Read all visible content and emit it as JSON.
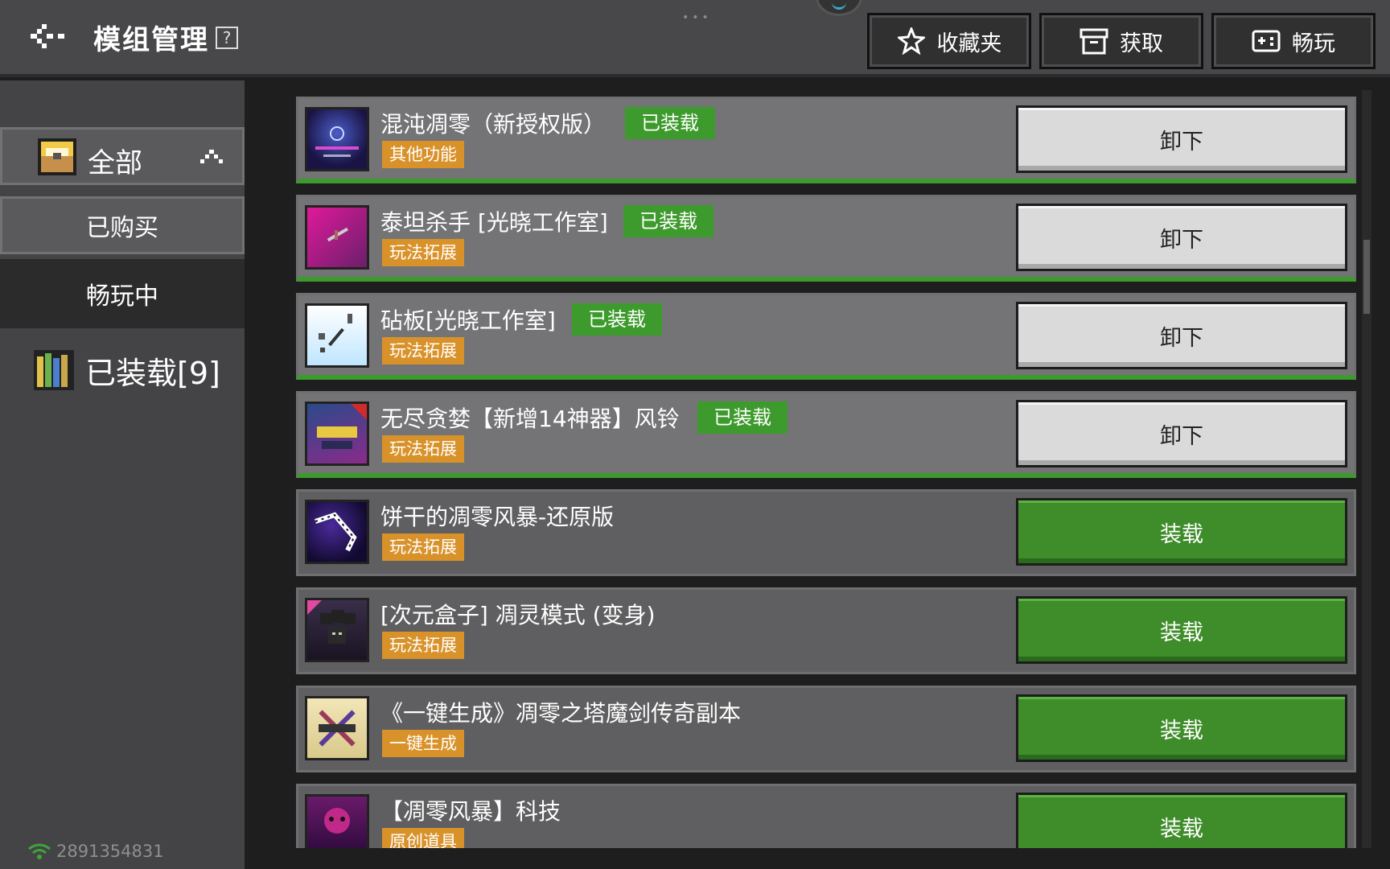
{
  "header": {
    "title": "模组管理",
    "help": "?",
    "buttons": [
      {
        "label": "收藏夹",
        "icon": "star-icon"
      },
      {
        "label": "获取",
        "icon": "box-icon"
      },
      {
        "label": "畅玩",
        "icon": "gamepad-icon"
      }
    ]
  },
  "sidebar": {
    "all": "全部",
    "bought": "已购买",
    "playing": "畅玩中",
    "loaded": "已装载[9]"
  },
  "footer": {
    "user_id": "2891354831"
  },
  "mods": [
    {
      "name": "混沌凋零（新授权版）",
      "tag": "其他功能",
      "badge": "已装载",
      "action": "卸下",
      "loaded": true
    },
    {
      "name": "泰坦杀手 [光晓工作室]",
      "tag": "玩法拓展",
      "badge": "已装载",
      "action": "卸下",
      "loaded": true
    },
    {
      "name": "砧板[光晓工作室]",
      "tag": "玩法拓展",
      "badge": "已装载",
      "action": "卸下",
      "loaded": true
    },
    {
      "name": "无尽贪婪【新增14神器】风铃",
      "tag": "玩法拓展",
      "badge": "已装载",
      "action": "卸下",
      "loaded": true
    },
    {
      "name": "饼干的凋零风暴-还原版",
      "tag": "玩法拓展",
      "action": "装载",
      "loaded": false
    },
    {
      "name": "[次元盒子] 凋灵模式 (变身)",
      "tag": "玩法拓展",
      "action": "装载",
      "loaded": false
    },
    {
      "name": "《一键生成》凋零之塔魔剑传奇副本",
      "tag": "一键生成",
      "action": "装载",
      "loaded": false
    },
    {
      "name": "【凋零风暴】科技",
      "tag": "原创道具",
      "action": "装载",
      "loaded": false
    }
  ],
  "colors": {
    "loaded_green": "#3d9a2c",
    "tag_orange": "#d9922a"
  }
}
